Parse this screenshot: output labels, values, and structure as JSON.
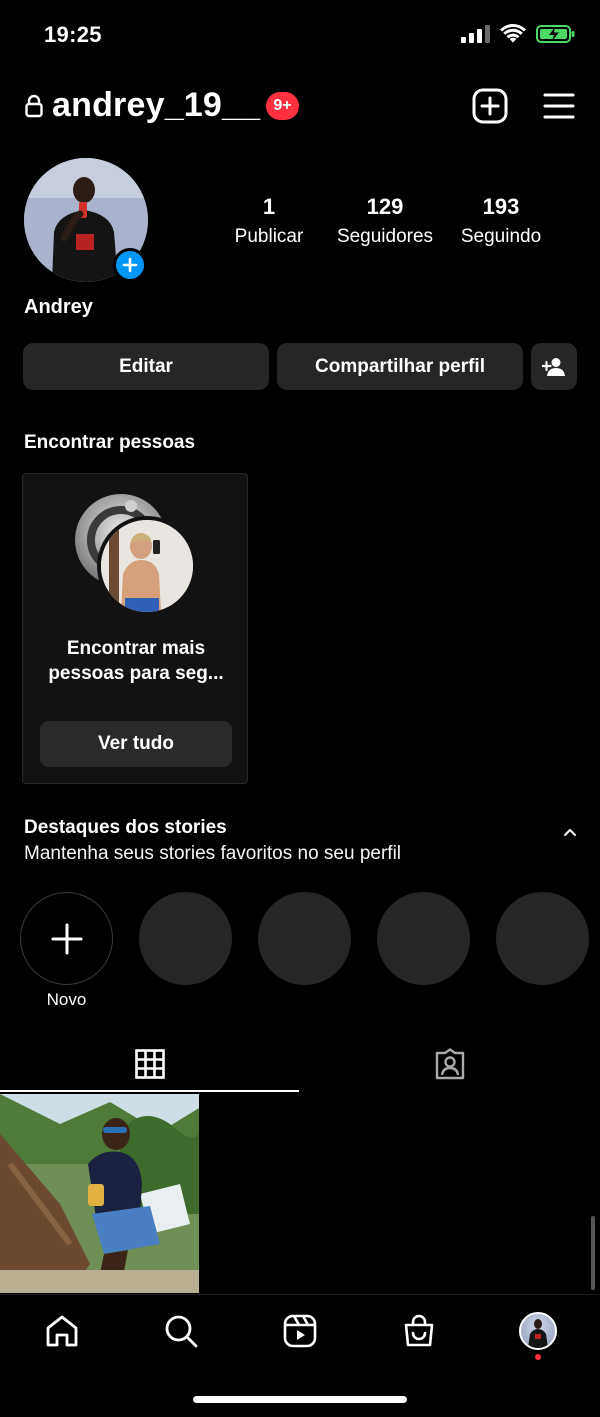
{
  "status_bar": {
    "time": "19:25"
  },
  "header": {
    "username": "andrey_19__",
    "notification_badge": "9+",
    "badge_color": "#ff3040"
  },
  "profile": {
    "display_name": "Andrey",
    "stats": [
      {
        "value": "1",
        "label": "Publicar"
      },
      {
        "value": "129",
        "label": "Seguidores"
      },
      {
        "value": "193",
        "label": "Seguindo"
      }
    ]
  },
  "actions": {
    "edit_label": "Editar",
    "share_label": "Compartilhar perfil"
  },
  "find_people": {
    "title": "Encontrar pessoas",
    "card_text_line1": "Encontrar mais",
    "card_text_line2": "pessoas para seg...",
    "see_all_label": "Ver tudo"
  },
  "highlights": {
    "title": "Destaques dos stories",
    "subtitle": "Mantenha seus stories favoritos no seu perfil",
    "new_label": "Novo"
  },
  "icons": {
    "lock": "lock-icon",
    "new_post": "add-post-icon",
    "menu": "hamburger-menu-icon",
    "discover_people": "add-person-icon",
    "collapse": "chevron-up-icon",
    "grid_tab": "grid-icon",
    "tagged_tab": "tagged-person-icon",
    "nav": [
      "home-icon",
      "search-icon",
      "reels-icon",
      "shop-icon",
      "profile-avatar"
    ]
  },
  "colors": {
    "accent": "#0095f6",
    "button_bg": "#262626",
    "notification": "#ff3040"
  }
}
